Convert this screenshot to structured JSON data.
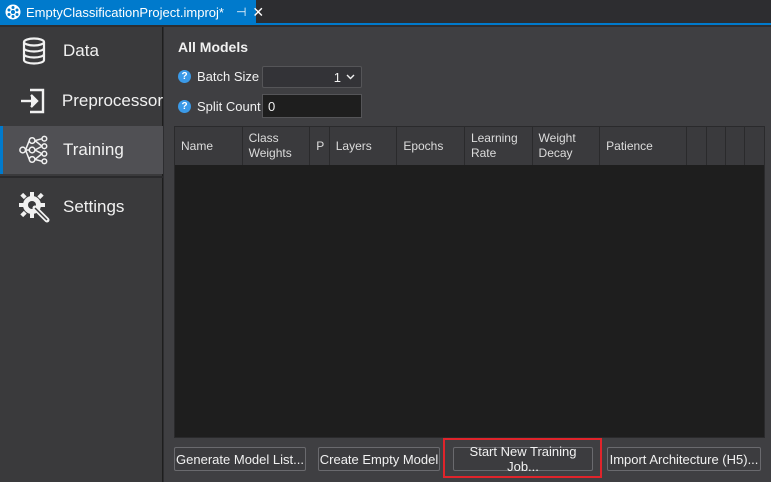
{
  "tab": {
    "title": "EmptyClassificationProject.improj*",
    "pin_glyph": "⊣",
    "close_glyph": "✕"
  },
  "sidebar": {
    "items": [
      {
        "label": "Data",
        "icon": "database-icon"
      },
      {
        "label": "Preprocessor",
        "icon": "sign-in-icon"
      },
      {
        "label": "Training",
        "icon": "neural-network-icon",
        "active": true
      },
      {
        "label": "Settings",
        "icon": "gear-wrench-icon"
      }
    ]
  },
  "main": {
    "title": "All Models",
    "batch_size": {
      "label": "Batch Size",
      "value": "1"
    },
    "split_count": {
      "label": "Split Count",
      "value": "0"
    },
    "help_glyph": "?",
    "grid": {
      "columns": [
        {
          "line1": "Name",
          "line2": ""
        },
        {
          "line1": "Class",
          "line2": "Weights"
        },
        {
          "line1": "P",
          "line2": ""
        },
        {
          "line1": "Layers",
          "line2": ""
        },
        {
          "line1": "Epochs",
          "line2": ""
        },
        {
          "line1": "Learning",
          "line2": "Rate"
        },
        {
          "line1": "Weight",
          "line2": "Decay"
        },
        {
          "line1": "Patience",
          "line2": ""
        }
      ]
    },
    "buttons": {
      "generate": "Generate Model List...",
      "create_empty": "Create Empty Model",
      "start_training": "Start New Training Job...",
      "import_arch": "Import Architecture (H5)..."
    }
  },
  "colors": {
    "accent": "#007acc",
    "highlight": "#e0242b"
  }
}
